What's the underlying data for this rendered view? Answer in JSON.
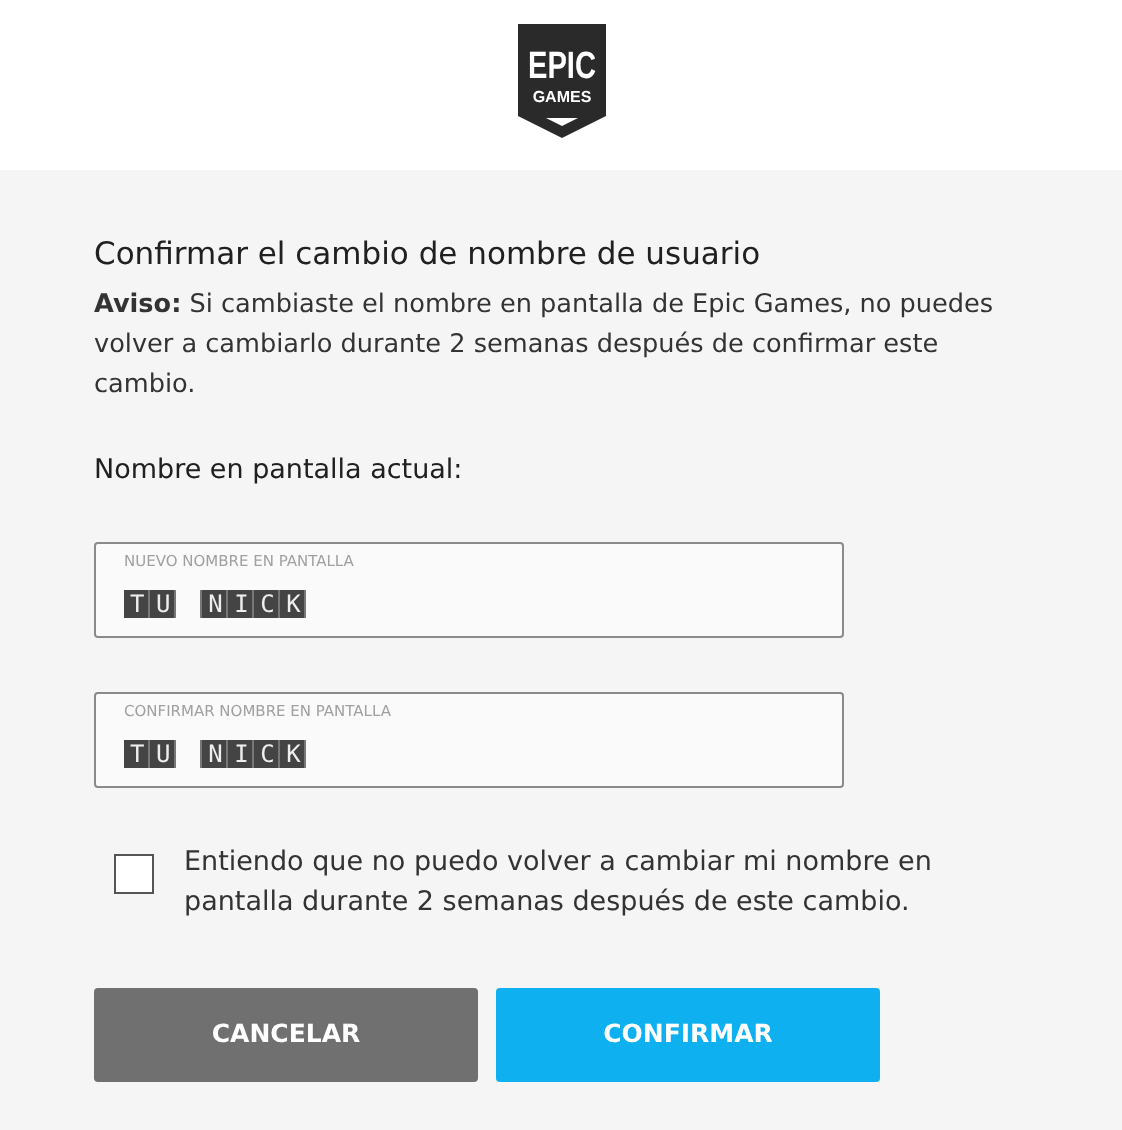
{
  "logo": {
    "lines": [
      "EPIC",
      "GAMES"
    ]
  },
  "dialog": {
    "title": "Confirmar el cambio de nombre de usuario",
    "notice": "**Aviso:** Si cambiaste el nombre en pantalla de Epic Games, no puedes volver a cambiarlo durante 2 semanas después de confirmar este cambio.",
    "current_label": "Nombre en pantalla actual:",
    "fields": [
      {
        "label": "NUEVO NOMBRE EN PANTALLA",
        "value": "TU NICK"
      },
      {
        "label": "CONFIRMAR NOMBRE EN PANTALLA",
        "value": "TU NICK"
      }
    ],
    "agreement": {
      "text": "Entiendo que no puedo volver a cambiar mi nombre en pantalla durante 2 semanas después de este cambio.",
      "checked": false
    },
    "buttons": [
      {
        "label": "CANCELAR",
        "kind": "secondary"
      },
      {
        "label": "CONFIRMAR",
        "kind": "primary"
      }
    ]
  }
}
